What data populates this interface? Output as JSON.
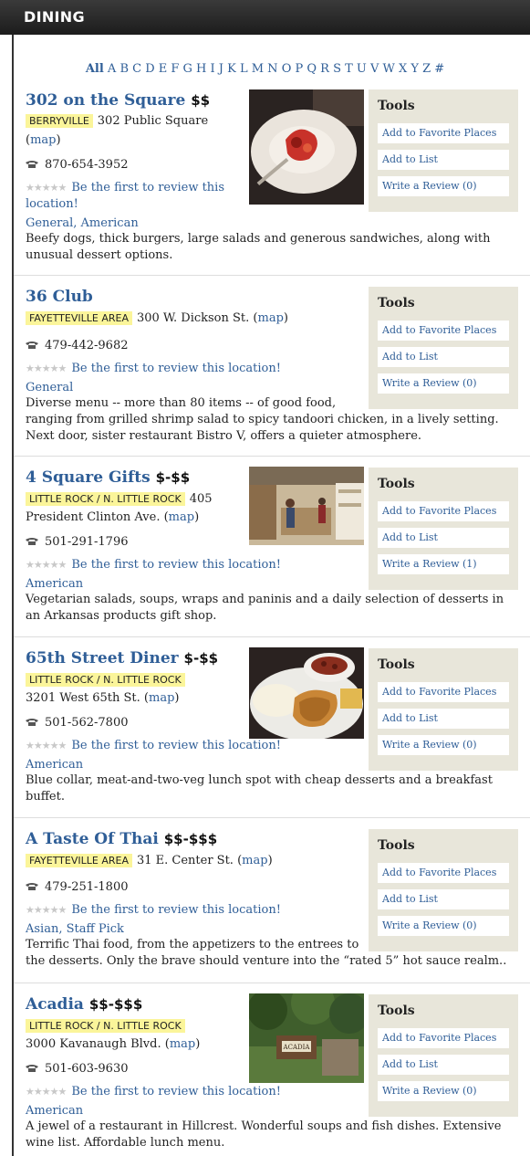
{
  "header": {
    "title": "DINING"
  },
  "alphabet": {
    "all": "All",
    "letters": "A B C D E F G H I J K L M N O P Q R S T U V W X Y Z #"
  },
  "common": {
    "stars": "★★★★★",
    "map": "map",
    "tools_title": "Tools",
    "add_fav": "Add to Favorite Places",
    "add_list": "Add to List"
  },
  "listings": [
    {
      "name": "302 on the Square",
      "price": "$$",
      "region": "BERRYVILLE",
      "address_part1": "302 Public Square",
      "phone": "870-654-3952",
      "review_part1": "Be the first to review this",
      "review_part2": "location!",
      "categories": "General, American",
      "desc": [
        "Beefy dogs, thick burgers, large salads and generous sandwiches, along with",
        "unusual dessert options."
      ],
      "write_review": "Write a Review (0)"
    },
    {
      "name": "36 Club",
      "price": "",
      "region": "FAYETTEVILLE AREA",
      "address": "300 W. Dickson St.",
      "phone": "479-442-9682",
      "review": "Be the first to review this location!",
      "categories": "General",
      "desc": [
        "Diverse menu -- more than 80 items -- of good food,",
        "ranging from grilled shrimp salad to spicy tandoori chicken, in a lively setting.",
        "Next door, sister restaurant Bistro V, offers a quieter atmosphere."
      ],
      "write_review": "Write a Review (0)"
    },
    {
      "name": "4 Square Gifts",
      "price": "$-$$",
      "region": "LITTLE ROCK / N. LITTLE ROCK",
      "address_part1": "405",
      "address_part2": "President Clinton Ave.",
      "phone": "501-291-1796",
      "review": "Be the first to review this location!",
      "categories": "American",
      "desc": [
        "Vegetarian salads, soups, wraps and paninis and a daily selection of desserts in",
        "an Arkansas products gift shop."
      ],
      "write_review": "Write a Review (1)"
    },
    {
      "name": "65th Street Diner",
      "price": "$-$$",
      "region": "LITTLE ROCK / N. LITTLE ROCK",
      "address": "3201 West 65th St.",
      "phone": "501-562-7800",
      "review": "Be the first to review this location!",
      "categories": "American",
      "desc": [
        "Blue collar, meat-and-two-veg lunch spot with cheap desserts and a breakfast",
        "buffet."
      ],
      "write_review": "Write a Review (0)"
    },
    {
      "name": "A Taste Of Thai",
      "price": "$$-$$$",
      "region": "FAYETTEVILLE AREA",
      "address": "31 E. Center St.",
      "phone": "479-251-1800",
      "review": "Be the first to review this location!",
      "categories": "Asian, Staff Pick",
      "desc": [
        "Terrific Thai food, from the appetizers to the entrees to",
        "the desserts. Only the brave should venture into the “rated 5” hot sauce realm.."
      ],
      "write_review": "Write a Review (0)"
    },
    {
      "name": "Acadia",
      "price": "$$-$$$",
      "region": "LITTLE ROCK / N. LITTLE ROCK",
      "address": "3000 Kavanaugh Blvd.",
      "phone": "501-603-9630",
      "review": "Be the first to review this location!",
      "categories": "American",
      "desc": [
        "A jewel of a restaurant in Hillcrest. Wonderful soups and fish dishes. Extensive",
        "wine list. Affordable lunch menu."
      ],
      "write_review": "Write a Review (0)",
      "sign_text": "ACADIA"
    }
  ]
}
